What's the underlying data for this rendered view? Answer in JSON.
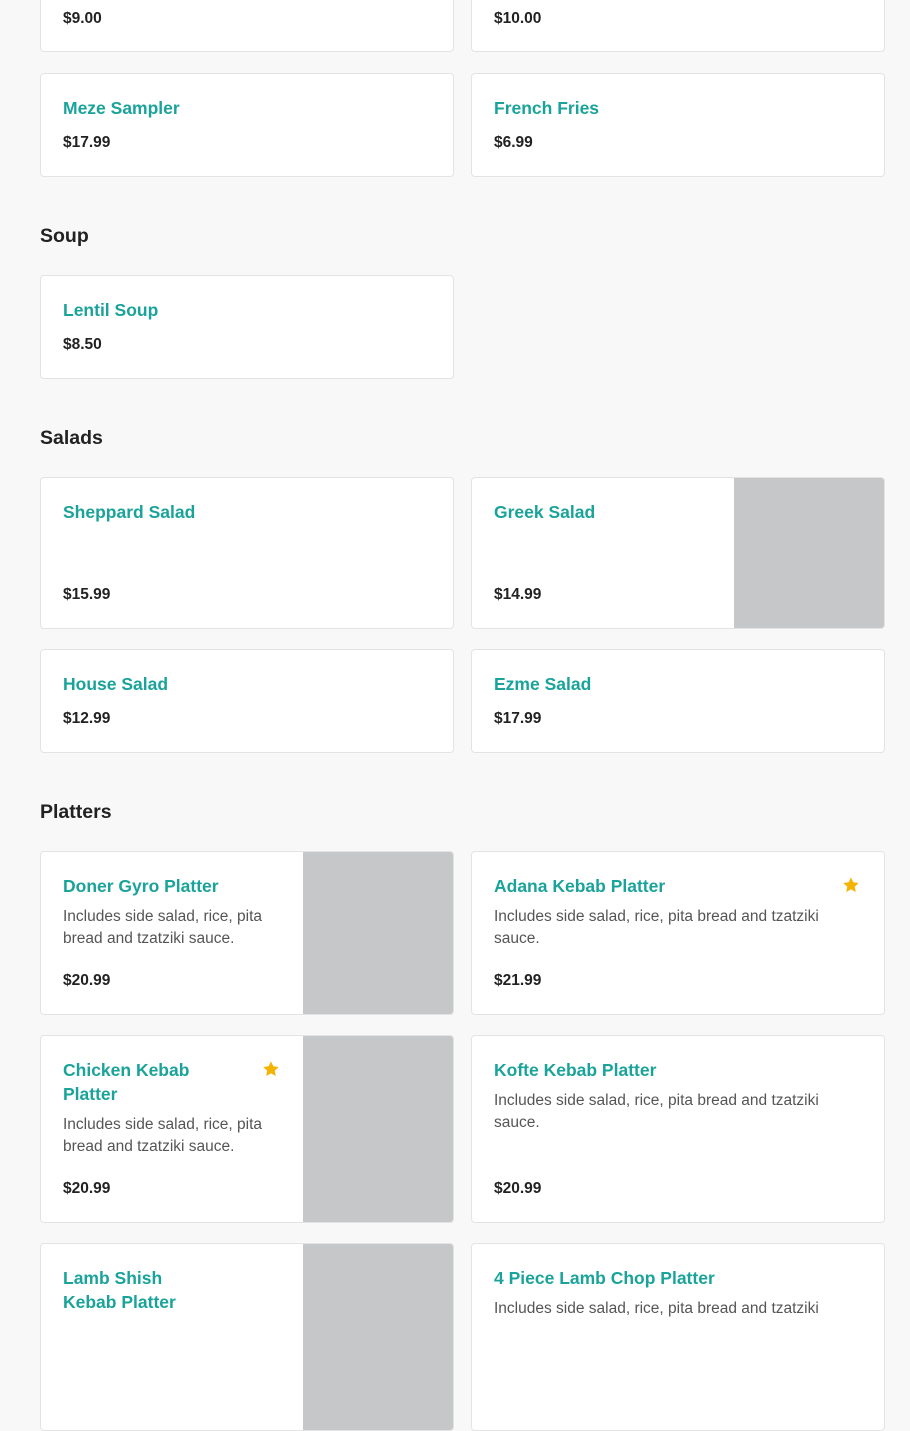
{
  "colors": {
    "accent": "#1aa39a",
    "star": "#f5b301",
    "thumb_placeholder": "#c6c7c9"
  },
  "top_items": [
    {
      "name": "",
      "price": "$9.00"
    },
    {
      "name": "",
      "price": "$10.00"
    },
    {
      "name": "Meze Sampler",
      "price": "$17.99"
    },
    {
      "name": "French Fries",
      "price": "$6.99"
    }
  ],
  "sections": {
    "soup": {
      "title": "Soup",
      "items": [
        {
          "name": "Lentil Soup",
          "price": "$8.50"
        }
      ]
    },
    "salads": {
      "title": "Salads",
      "items": [
        {
          "name": "Sheppard Salad",
          "price": "$15.99"
        },
        {
          "name": "Greek Salad",
          "price": "$14.99"
        },
        {
          "name": "House Salad",
          "price": "$12.99"
        },
        {
          "name": "Ezme Salad",
          "price": "$17.99"
        }
      ]
    },
    "platters": {
      "title": "Platters",
      "items": [
        {
          "name": "Doner Gyro Platter",
          "desc": "Includes side salad, rice, pita bread and tzatziki sauce.",
          "price": "$20.99"
        },
        {
          "name": "Adana Kebab Platter",
          "desc": "Includes side salad, rice, pita bread and tzatziki sauce.",
          "price": "$21.99",
          "featured_icon": "star-icon"
        },
        {
          "name": "Chicken Kebab Platter",
          "desc": "Includes side salad, rice, pita bread and tzatziki sauce.",
          "price": "$20.99",
          "featured_icon": "star-icon"
        },
        {
          "name": "Kofte Kebab Platter",
          "desc": "Includes side salad, rice, pita bread and tzatziki sauce.",
          "price": "$20.99"
        },
        {
          "name": "Lamb Shish Kebab Platter"
        },
        {
          "name": "4 Piece Lamb Chop Platter",
          "desc": "Includes side salad, rice, pita bread and tzatziki"
        }
      ]
    }
  }
}
